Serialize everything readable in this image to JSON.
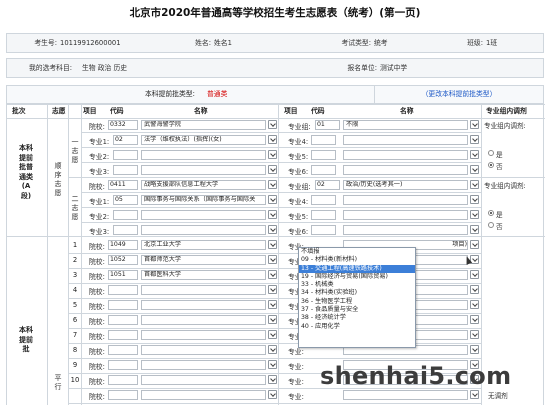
{
  "page_title": "北京市2020年普通高等学校招生考生志愿表（统考）(第一页)",
  "info": {
    "exam_no_label": "考生号:",
    "exam_no": "10119912600001",
    "name_label": "姓名:",
    "name": "姓名1",
    "exam_type_label": "考试类型:",
    "exam_type": "统考",
    "class_label": "班级:",
    "class": "1班",
    "subjects_label": "我的选考科目:",
    "subjects": "生物 政治 历史",
    "unit_label": "报名单位:",
    "unit": "测试中学"
  },
  "batch_prompt": {
    "label": "本科提前批类型:",
    "type": "普通类",
    "change_link": "（更改本科提前批类型）"
  },
  "headers": {
    "batch": "批次",
    "volunteer": "志愿",
    "item": "项目",
    "code": "代码",
    "name": "名称",
    "item2": "项目",
    "code2": "代码",
    "name2": "名称",
    "adjust": "专业组内调剂"
  },
  "section_a": {
    "label": "本科提前批普通类(A段)",
    "order_label": "顺序志愿",
    "vol1": "一志愿",
    "vol2": "二志愿",
    "adjust_caption": "专业组内调剂:",
    "yes": "是",
    "no": "否",
    "groups": [
      {
        "school_label": "院校:",
        "school_code": "0332",
        "school_name": "武警海警学院",
        "major_label": "专业组:",
        "major_code": "01",
        "major_name": "不限",
        "rows": [
          {
            "label": "专业1:",
            "code": "02",
            "name": "法学（维权执法）(指挥)(女)",
            "r_label": "专业4:"
          },
          {
            "label": "专业2:",
            "code": "",
            "name": "",
            "r_label": "专业5:"
          },
          {
            "label": "专业3:",
            "code": "",
            "name": "",
            "r_label": "专业6:"
          }
        ]
      },
      {
        "school_label": "院校:",
        "school_code": "0411",
        "school_name": "战略支援部队信息工程大学",
        "major_label": "专业组:",
        "major_code": "02",
        "major_name": "政治/历史(选考其一)",
        "rows": [
          {
            "label": "专业1:",
            "code": "05",
            "name": "国际事务与国际关系（国际事务与国际关",
            "r_label": "专业4:"
          },
          {
            "label": "专业2:",
            "code": "",
            "name": "",
            "r_label": "专业5:"
          },
          {
            "label": "专业3:",
            "code": "",
            "name": "",
            "r_label": "专业6:"
          }
        ]
      }
    ]
  },
  "section_b": {
    "label": "本科提前批",
    "parallel_label": "平行",
    "no_adjust": "无调剂",
    "schools": [
      {
        "n": "1",
        "label": "院校:",
        "code": "1049",
        "name": "北京工业大学",
        "r_label": "专业:",
        "r_code": "",
        "r_name": "项目)"
      },
      {
        "n": "2",
        "label": "院校:",
        "code": "1052",
        "name": "首都师范大学",
        "r_label": "专业:"
      },
      {
        "n": "3",
        "label": "院校:",
        "code": "1051",
        "name": "首都医科大学",
        "r_label": "专业:"
      },
      {
        "n": "4",
        "label": "院校:",
        "code": "",
        "name": "",
        "r_label": "专业:"
      },
      {
        "n": "5",
        "label": "院校:",
        "code": "",
        "name": "",
        "r_label": "专业:"
      },
      {
        "n": "6",
        "label": "院校:",
        "code": "",
        "name": "",
        "r_label": "专业:"
      },
      {
        "n": "7",
        "label": "院校:",
        "code": "",
        "name": "",
        "r_label": "专业:"
      },
      {
        "n": "8",
        "label": "院校:",
        "code": "",
        "name": "",
        "r_label": "专业:"
      },
      {
        "n": "9",
        "label": "院校:",
        "code": "",
        "name": "",
        "r_label": "专业:"
      },
      {
        "n": "10",
        "label": "院校:",
        "code": "",
        "name": "",
        "r_label": "专业:"
      },
      {
        "n": "",
        "label": "院校:",
        "code": "",
        "name": "",
        "r_label": "专业:"
      }
    ]
  },
  "dropdown_options": [
    "不填报",
    "09 - 材料类(新材料)",
    "13 - 交通工程(高速铁路技术)",
    "19 - 国际经济与贸易(国际贸易)",
    "33 - 机械类",
    "34 - 材料类(实验班)",
    "36 - 生物医学工程",
    "37 - 食品质量与安全",
    "38 - 经济统计学",
    "40 - 应用化学"
  ],
  "dropdown_selected_index": 2,
  "watermark": "shenhai5.com",
  "colors": {
    "accent_red": "#d40000",
    "link_blue": "#1a56c6",
    "highlight": "#3c7fd8"
  }
}
